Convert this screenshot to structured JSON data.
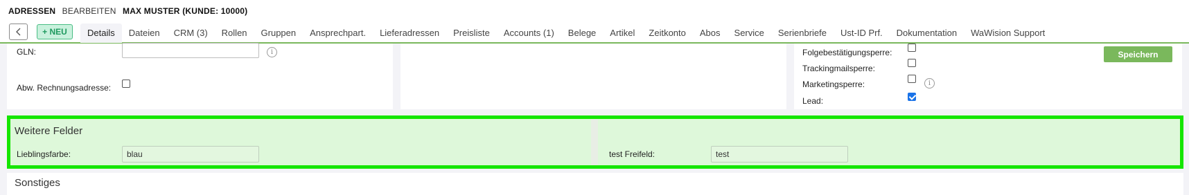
{
  "header": {
    "breadcrumb_section": "ADRESSEN",
    "breadcrumb_mode": "BEARBEITEN",
    "breadcrumb_record": "MAX MUSTER (KUNDE: 10000)",
    "back_label": "<",
    "new_button": "+ NEU",
    "tabs": [
      {
        "label": "Details",
        "active": true
      },
      {
        "label": "Dateien"
      },
      {
        "label": "CRM (3)"
      },
      {
        "label": "Rollen"
      },
      {
        "label": "Gruppen"
      },
      {
        "label": "Ansprechpart."
      },
      {
        "label": "Lieferadressen"
      },
      {
        "label": "Preisliste"
      },
      {
        "label": "Accounts (1)"
      },
      {
        "label": "Belege"
      },
      {
        "label": "Artikel"
      },
      {
        "label": "Zeitkonto"
      },
      {
        "label": "Abos"
      },
      {
        "label": "Service"
      },
      {
        "label": "Serienbriefe"
      },
      {
        "label": "Ust-ID Prf."
      },
      {
        "label": "Dokumentation"
      },
      {
        "label": "WaWision Support"
      }
    ]
  },
  "form_left": {
    "gln_label": "GLN:",
    "gln_value": "",
    "abw_label": "Abw. Rechnungsadresse:",
    "abw_checked": false
  },
  "form_right": {
    "folge_label": "Folgebestätigungsperre:",
    "tracking_label": "Trackingmailsperre:",
    "marketing_label": "Marketingsperre:",
    "lead_label": "Lead:",
    "lead_checked": true,
    "save_button": "Speichern"
  },
  "weitere_felder": {
    "title": "Weitere Felder",
    "field1_label": "Lieblingsfarbe:",
    "field1_value": "blau",
    "field2_label": "test Freifeld:",
    "field2_value": "test"
  },
  "sonstiges": {
    "title": "Sonstiges"
  },
  "colors": {
    "accent_green": "#7ab85c",
    "highlight_border": "#15e600",
    "highlight_bg": "#def8da",
    "checkbox_blue": "#1a73e8"
  },
  "icons": [
    "back-arrow-icon",
    "info-icon",
    "checkmark-icon"
  ]
}
